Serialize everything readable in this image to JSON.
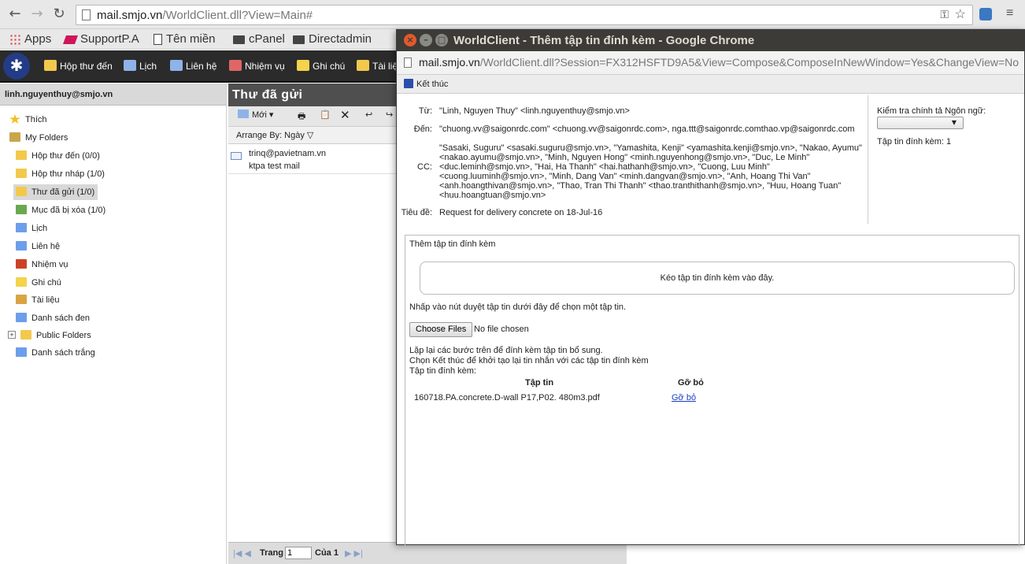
{
  "browser": {
    "url_host": "mail.smjo.vn",
    "url_rest": "/WorldClient.dll?View=Main#",
    "bookmarks": [
      {
        "label": "Apps",
        "icon": "apps-grid-icon"
      },
      {
        "label": "SupportP.A",
        "icon": "support-icon"
      },
      {
        "label": "Tên miền",
        "icon": "page-icon"
      },
      {
        "label": "cPanel",
        "icon": "folder-icon"
      },
      {
        "label": "Directadmin",
        "icon": "folder-icon"
      }
    ]
  },
  "app_nav": [
    {
      "label": "Hộp thư đến",
      "color": "#f2c94c"
    },
    {
      "label": "Lịch",
      "color": "#8fb3e8"
    },
    {
      "label": "Liên hệ",
      "color": "#8fb3e8"
    },
    {
      "label": "Nhiệm vụ",
      "color": "#e06666"
    },
    {
      "label": "Ghi chú",
      "color": "#f5d34b"
    },
    {
      "label": "Tài liệ",
      "color": "#f2c94c"
    }
  ],
  "sidebar": {
    "account": "linh.nguyenthuy@smjo.vn",
    "folders": [
      {
        "label": "Thích",
        "icon": "star-icon",
        "color": "#f0c020"
      },
      {
        "label": "My Folders",
        "icon": "folders-icon",
        "color": "#c9a64b"
      },
      {
        "label": "Hộp thư đến (0/0)",
        "icon": "inbox-icon",
        "color": "#f2c94c"
      },
      {
        "label": "Hộp thư nháp (1/0)",
        "icon": "drafts-icon",
        "color": "#f2c94c"
      },
      {
        "label": "Thư đã gửi (1/0)",
        "icon": "sent-icon",
        "color": "#f2c94c"
      },
      {
        "label": "Mục đã bị xóa (1/0)",
        "icon": "trash-icon",
        "color": "#6aa84f"
      },
      {
        "label": "Lịch",
        "icon": "calendar-icon",
        "color": "#6d9eeb"
      },
      {
        "label": "Liên hệ",
        "icon": "contacts-icon",
        "color": "#6d9eeb"
      },
      {
        "label": "Nhiệm vụ",
        "icon": "tasks-icon",
        "color": "#cc4125"
      },
      {
        "label": "Ghi chú",
        "icon": "notes-icon",
        "color": "#f5d34b"
      },
      {
        "label": "Tài liệu",
        "icon": "documents-icon",
        "color": "#d9a441"
      },
      {
        "label": "Danh sách đen",
        "icon": "blacklist-icon",
        "color": "#6d9eeb"
      },
      {
        "label": "Public Folders",
        "icon": "public-folders-icon",
        "color": "#f2c94c"
      },
      {
        "label": "Danh sách trắng",
        "icon": "whitelist-icon",
        "color": "#6d9eeb"
      }
    ],
    "expand_symbol": "+"
  },
  "messages": {
    "title": "Thư đã gửi",
    "new_label": "Mới",
    "arrange_label": "Arrange By:",
    "arrange_value": "Ngày",
    "items": [
      {
        "from": "trinq@pavietnam.vn",
        "subject": "ktpa test mail"
      }
    ],
    "pager": {
      "page_label": "Trang",
      "page_value": "1",
      "of_label": "Của 1"
    }
  },
  "popup": {
    "title": "WorldClient - Thêm tập tin đính kèm - Google Chrome",
    "url_host": "mail.smjo.vn",
    "url_rest": "/WorldClient.dll?Session=FX312HSFTD9A5&View=Compose&ComposeInNewWindow=Yes&ChangeView=No",
    "finish_label": "Kết thúc",
    "header": {
      "from_key": "Từ:",
      "from_value": "\"Linh, Nguyen Thuy\" <linh.nguyenthuy@smjo.vn>",
      "to_key": "Đến:",
      "to_value": "\"chuong.vv@saigonrdc.com\" <chuong.vv@saigonrdc.com>, nga.ttt@saigonrdc.comthao.vp@saigonrdc.com",
      "cc_key": "CC:",
      "cc_lines": [
        "\"Sasaki, Suguru\" <sasaki.suguru@smjo.vn>, \"Yamashita, Kenji\" <yamashita.kenji@smjo.vn>, \"Nakao, Ayumu\"",
        "<nakao.ayumu@smjo.vn>, \"Minh, Nguyen Hong\" <minh.nguyenhong@smjo.vn>, \"Duc, Le Minh\"",
        "<duc.leminh@smjo.vn>, \"Hai, Ha Thanh\" <hai.hathanh@smjo.vn>, \"Cuong, Luu Minh\"",
        "<cuong.luuminh@smjo.vn>, \"Minh, Dang Van\" <minh.dangvan@smjo.vn>, \"Anh, Hoang Thi Van\"",
        "<anh.hoangthivan@smjo.vn>, \"Thao, Tran Thi Thanh\" <thao.tranthithanh@smjo.vn>, \"Huu, Hoang Tuan\"",
        "<huu.hoangtuan@smjo.vn>"
      ],
      "subject_key": "Tiêu đề:",
      "subject_value": "Request for delivery concrete on 18-Jul-16",
      "spell_label": "Kiểm tra chính tả Ngôn ngữ:",
      "attach_count": "Tập tin đính kèm: 1"
    },
    "attach": {
      "heading": "Thêm tập tin đính kèm",
      "dropzone": "Kéo tập tin đính kèm vào đây.",
      "browse_hint": "Nhấp vào nút duyệt tập tin dưới đây để chọn một tập tin.",
      "choose_button": "Choose Files",
      "no_file": "No file chosen",
      "repeat_hint": "Lặp lại các bước trên để đính kèm tập tin bổ sung.",
      "finish_hint": "Chọn Kết thúc để khởi tạo lại tin nhắn với các tập tin đính kèm",
      "list_label": "Tập tin đính kèm:",
      "col_file": "Tập tin",
      "col_remove": "Gỡ bỏ",
      "files": [
        {
          "name": "160718.PA.concrete.D-wall P17,P02. 480m3.pdf",
          "remove": "Gỡ bỏ"
        }
      ]
    }
  }
}
